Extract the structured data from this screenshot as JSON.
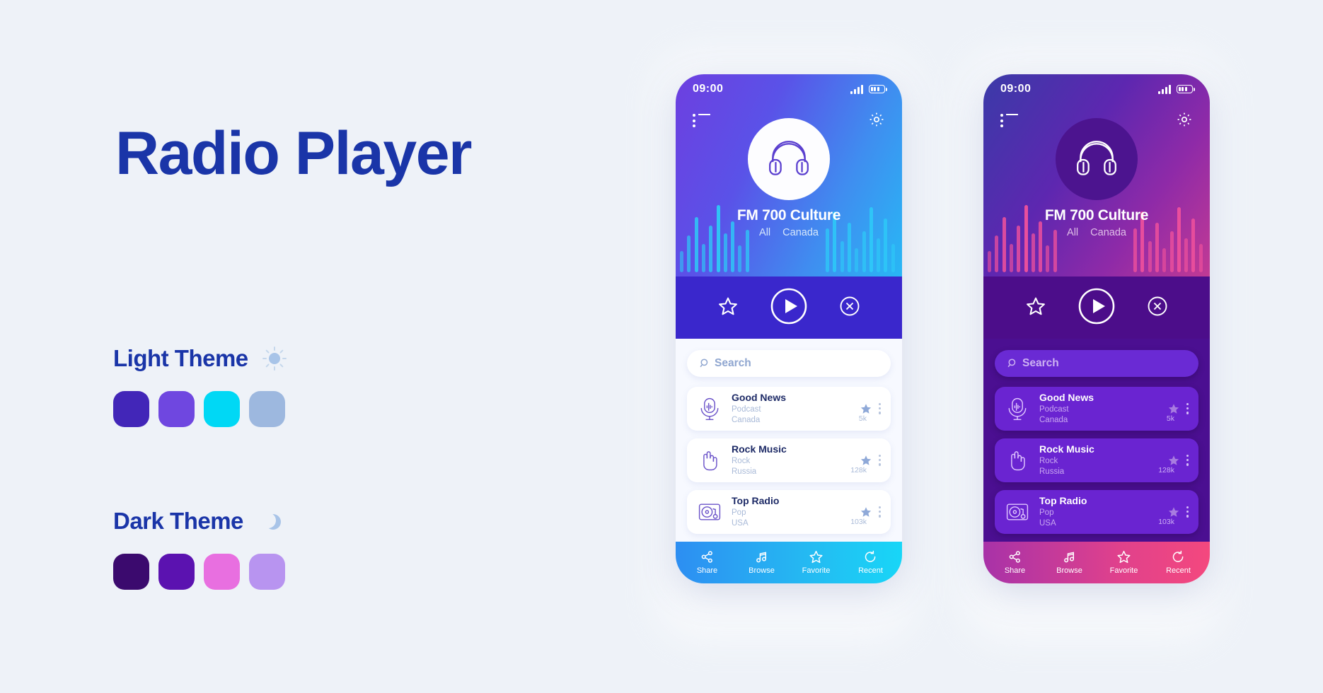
{
  "page": {
    "title": "Radio Player",
    "background_color": "#eef2f8",
    "title_color": "#1a35a8"
  },
  "themes": [
    {
      "name": "Light Theme",
      "icon": "sun-icon",
      "swatches": [
        "#4226b8",
        "#6f47e0",
        "#00d8f5",
        "#9db8df"
      ]
    },
    {
      "name": "Dark Theme",
      "icon": "moon-icon",
      "swatches": [
        "#3b0a6e",
        "#5b12b0",
        "#e86fe0",
        "#b894f0"
      ]
    }
  ],
  "screens": [
    {
      "variant": "light",
      "statusbar": {
        "time": "09:00",
        "signal_icon": "signal-bars-icon",
        "battery_icon": "battery-icon"
      },
      "topbar": {
        "menu_icon": "list-menu-icon",
        "settings_icon": "gear-icon"
      },
      "hero": {
        "artwork_icon": "headphones-icon",
        "station_title": "FM 700 Culture",
        "genre": "All",
        "country": "Canada"
      },
      "controls": {
        "favorite_icon": "star-outline-icon",
        "play_icon": "play-circle-icon",
        "close_icon": "close-circle-icon"
      },
      "search": {
        "placeholder": "Search",
        "icon": "search-icon"
      },
      "stations": [
        {
          "icon": "microphone-icon",
          "title": "Good News",
          "genre": "Podcast",
          "country": "Canada",
          "listeners": "5k",
          "star_icon": "star-filled-icon",
          "menu_icon": "more-vertical-icon"
        },
        {
          "icon": "rock-hand-icon",
          "title": "Rock Music",
          "genre": "Rock",
          "country": "Russia",
          "listeners": "128k",
          "star_icon": "star-filled-icon",
          "menu_icon": "more-vertical-icon"
        },
        {
          "icon": "turntable-icon",
          "title": "Top Radio",
          "genre": "Pop",
          "country": "USA",
          "listeners": "103k",
          "star_icon": "star-filled-icon",
          "menu_icon": "more-vertical-icon"
        }
      ],
      "bottomnav": [
        {
          "label": "Share",
          "icon": "share-icon"
        },
        {
          "label": "Browse",
          "icon": "music-note-icon"
        },
        {
          "label": "Favorite",
          "icon": "star-outline-icon"
        },
        {
          "label": "Recent",
          "icon": "refresh-icon"
        }
      ]
    },
    {
      "variant": "dark",
      "statusbar": {
        "time": "09:00",
        "signal_icon": "signal-bars-icon",
        "battery_icon": "battery-icon"
      },
      "topbar": {
        "menu_icon": "list-menu-icon",
        "settings_icon": "gear-icon"
      },
      "hero": {
        "artwork_icon": "headphones-icon",
        "station_title": "FM 700 Culture",
        "genre": "All",
        "country": "Canada"
      },
      "controls": {
        "favorite_icon": "star-outline-icon",
        "play_icon": "play-circle-icon",
        "close_icon": "close-circle-icon"
      },
      "search": {
        "placeholder": "Search",
        "icon": "search-icon"
      },
      "stations": [
        {
          "icon": "microphone-icon",
          "title": "Good News",
          "genre": "Podcast",
          "country": "Canada",
          "listeners": "5k",
          "star_icon": "star-filled-icon",
          "menu_icon": "more-vertical-icon"
        },
        {
          "icon": "rock-hand-icon",
          "title": "Rock Music",
          "genre": "Rock",
          "country": "Russia",
          "listeners": "128k",
          "star_icon": "star-filled-icon",
          "menu_icon": "more-vertical-icon"
        },
        {
          "icon": "turntable-icon",
          "title": "Top Radio",
          "genre": "Pop",
          "country": "USA",
          "listeners": "103k",
          "star_icon": "star-filled-icon",
          "menu_icon": "more-vertical-icon"
        }
      ],
      "bottomnav": [
        {
          "label": "Share",
          "icon": "share-icon"
        },
        {
          "label": "Browse",
          "icon": "music-note-icon"
        },
        {
          "label": "Favorite",
          "icon": "star-outline-icon"
        },
        {
          "label": "Recent",
          "icon": "refresh-icon"
        }
      ]
    }
  ]
}
